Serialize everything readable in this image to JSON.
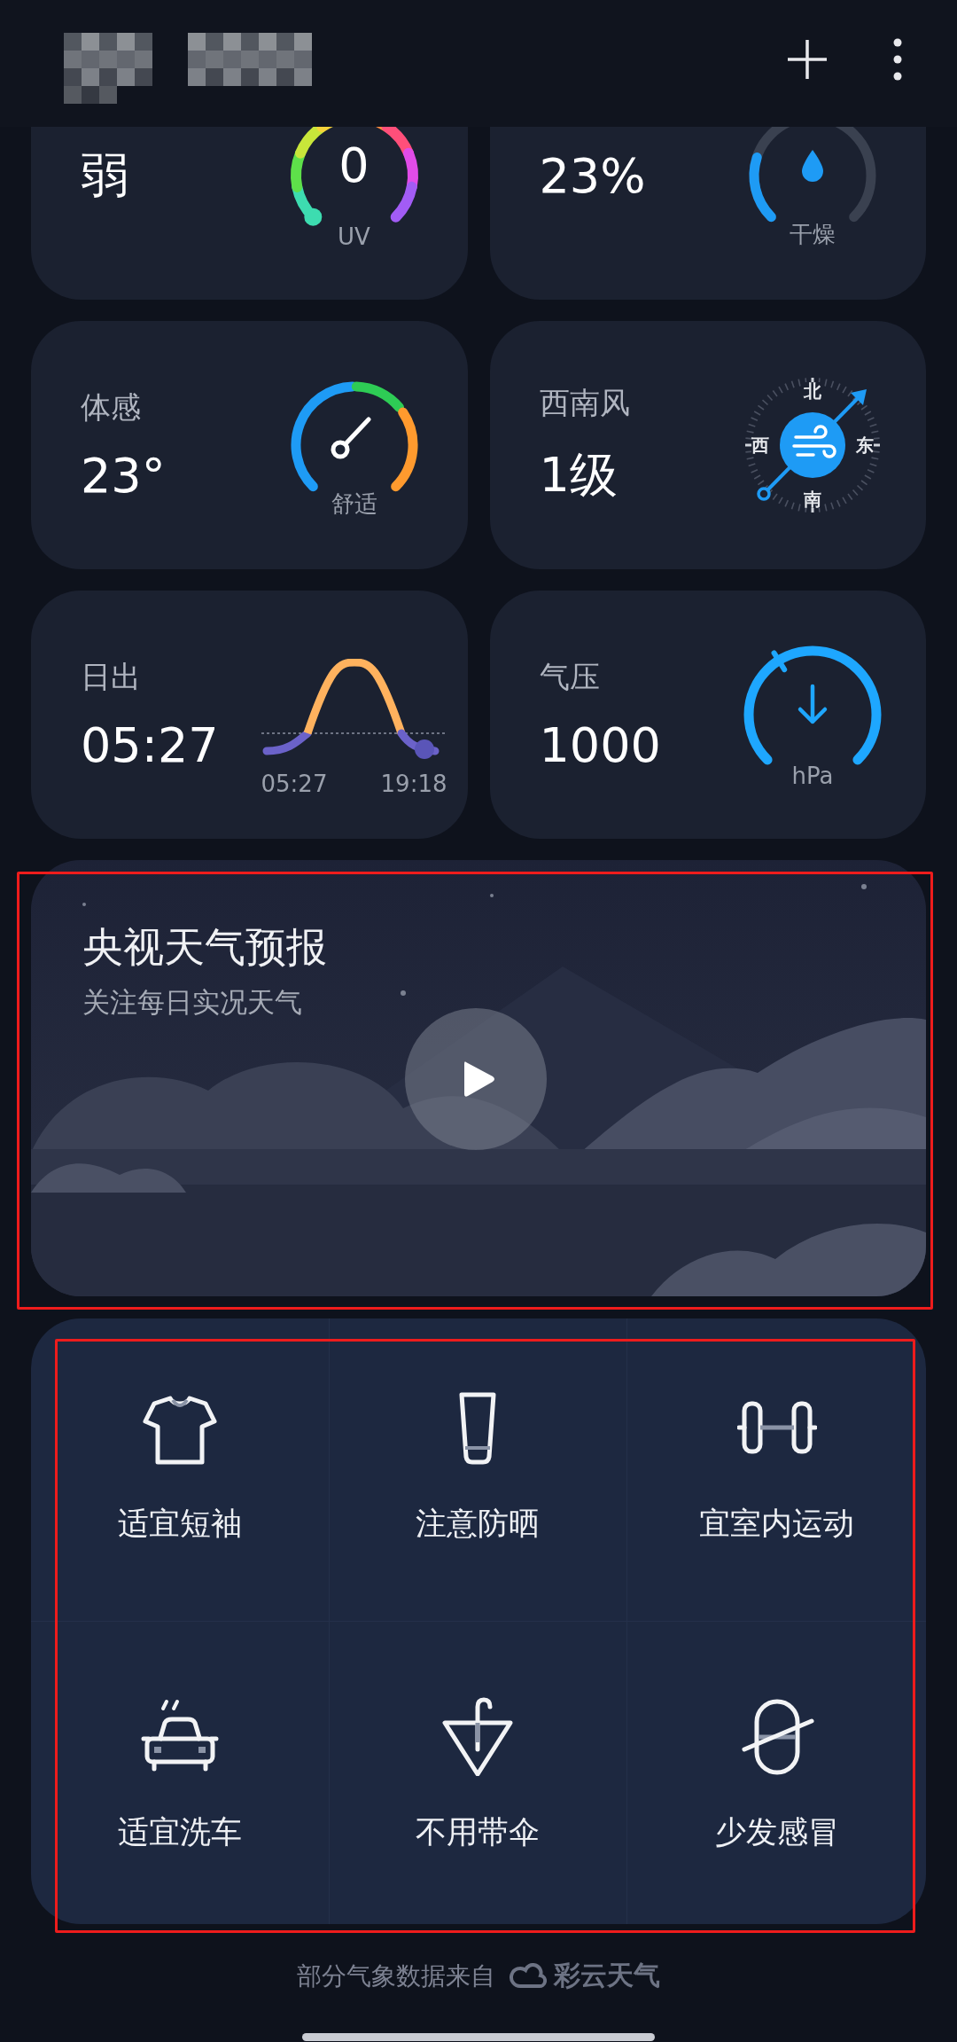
{
  "metrics": [
    {
      "kind": "uv",
      "value": "弱",
      "gauge_value": "0",
      "gauge_unit": "UV"
    },
    {
      "kind": "humidity",
      "value": "23%",
      "gauge_caption": "干燥"
    },
    {
      "kind": "feels_like",
      "label": "体感",
      "value": "23°",
      "gauge_caption": "舒适"
    },
    {
      "kind": "wind",
      "label": "西南风",
      "value": "1级",
      "north": "北",
      "west": "西",
      "east": "东",
      "south": "南"
    },
    {
      "kind": "sunrise",
      "label": "日出",
      "value": "05:27",
      "start_time": "05:27",
      "end_time": "19:18"
    },
    {
      "kind": "pressure",
      "label": "气压",
      "value": "1000",
      "gauge_unit": "hPa"
    }
  ],
  "video_card": {
    "title": "央视天气预报",
    "subtitle": "关注每日实况天气",
    "highlighted": true
  },
  "tips": {
    "highlighted": true,
    "items": [
      {
        "kind": "tshirt",
        "label": "适宜短袖"
      },
      {
        "kind": "sunscreen",
        "label": "注意防晒"
      },
      {
        "kind": "dumbbell",
        "label": "宜室内运动"
      },
      {
        "kind": "car",
        "label": "适宜洗车"
      },
      {
        "kind": "umbrella",
        "label": "不用带伞"
      },
      {
        "kind": "capsule",
        "label": "少发感冒"
      }
    ]
  },
  "footer": {
    "text": "部分气象数据来自",
    "brand": "彩云天气"
  }
}
